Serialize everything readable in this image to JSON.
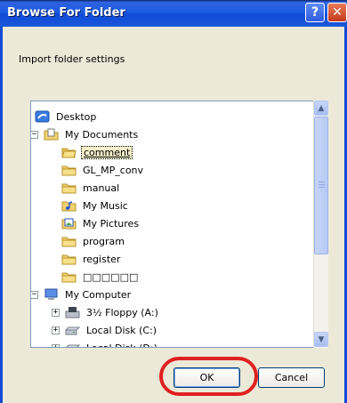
{
  "window": {
    "title": "Browse For Folder"
  },
  "title_buttons": {
    "help_glyph": "?",
    "close_glyph": "✕"
  },
  "instruction": "Import folder settings",
  "tree": {
    "items": [
      {
        "label": "Desktop",
        "icon": "desktop-icon",
        "expander": "",
        "selected": false
      },
      {
        "label": "My Documents",
        "icon": "my-documents-icon",
        "expander": "−",
        "selected": false
      },
      {
        "label": "comment",
        "icon": "folder-open-icon",
        "expander": "",
        "selected": true
      },
      {
        "label": "GL_MP_conv",
        "icon": "folder-icon",
        "expander": "",
        "selected": false
      },
      {
        "label": "manual",
        "icon": "folder-icon",
        "expander": "",
        "selected": false
      },
      {
        "label": "My Music",
        "icon": "my-music-icon",
        "expander": "",
        "selected": false
      },
      {
        "label": "My Pictures",
        "icon": "my-pictures-icon",
        "expander": "",
        "selected": false
      },
      {
        "label": "program",
        "icon": "folder-icon",
        "expander": "",
        "selected": false
      },
      {
        "label": "register",
        "icon": "folder-icon",
        "expander": "",
        "selected": false
      },
      {
        "label": "□□□□□□",
        "icon": "folder-icon",
        "expander": "",
        "selected": false
      },
      {
        "label": "My Computer",
        "icon": "my-computer-icon",
        "expander": "−",
        "selected": false
      },
      {
        "label": "3½ Floppy (A:)",
        "icon": "floppy-drive-icon",
        "expander": "+",
        "selected": false
      },
      {
        "label": "Local Disk (C:)",
        "icon": "hard-drive-icon",
        "expander": "+",
        "selected": false
      },
      {
        "label": "Local Disk (D:)",
        "icon": "hard-drive-icon",
        "expander": "+",
        "selected": false
      }
    ]
  },
  "scrollbar": {
    "up_glyph": "▲",
    "down_glyph": "▼"
  },
  "buttons": {
    "ok": "OK",
    "cancel": "Cancel"
  },
  "colors": {
    "titlebar": "#0F4BD8",
    "dialog_bg": "#ECE9D8",
    "highlight": "#E02020",
    "selection": "#F5EFCB"
  }
}
